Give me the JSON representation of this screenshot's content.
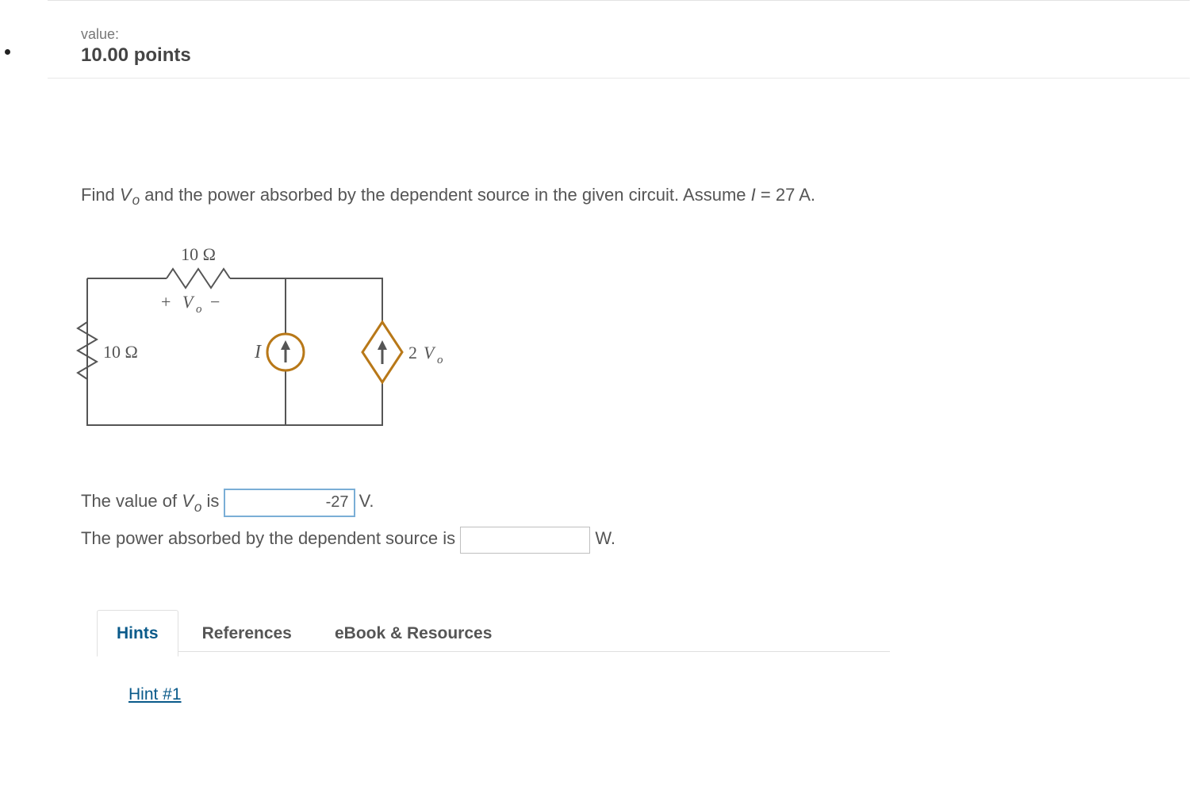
{
  "header": {
    "value_label": "value:",
    "points": "10.00 points"
  },
  "question": {
    "prefix": "Find ",
    "vo_html": "V",
    "vo_sub": "o",
    "mid": " and the power absorbed by the dependent source in the given circuit. Assume ",
    "ivar": "I",
    "tail": " = 27 A."
  },
  "diagram": {
    "r_top": "10 Ω",
    "vo_plus": "+ ",
    "vo_sym": "V",
    "vo_sub": "o",
    "vo_minus": " −",
    "r_left": "10 Ω",
    "i_label": "I",
    "dep_num": "2 ",
    "dep_v": "V",
    "dep_sub": "o"
  },
  "answers": {
    "row1_pre": "The value of ",
    "row1_v": "V",
    "row1_sub": "o",
    "row1_post": " is ",
    "row1_value": "-27",
    "row1_unit": " V.",
    "row2_pre": "The power absorbed by the dependent source is ",
    "row2_value": "",
    "row2_unit": " W."
  },
  "tabs": {
    "hints": "Hints",
    "references": "References",
    "ebook": "eBook & Resources"
  },
  "hints": {
    "link1": "Hint #1"
  }
}
